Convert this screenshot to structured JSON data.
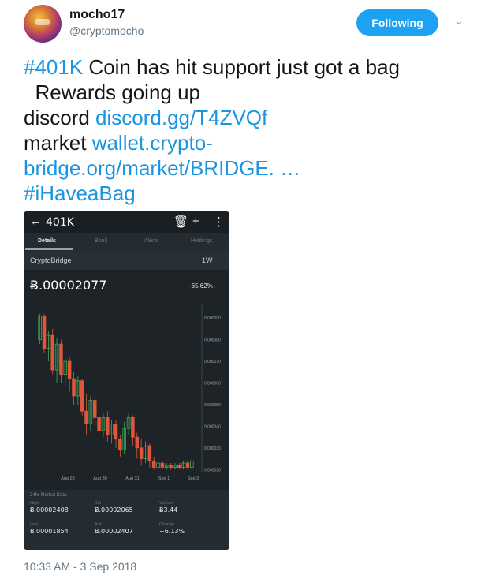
{
  "user": {
    "name": "mocho17",
    "handle": "@cryptomocho",
    "follow_label": "Following",
    "caret": "⌄"
  },
  "tweet": {
    "hashtag1": "#401K",
    "text1": " Coin has hit support  just got a bag",
    "text2": "  Rewards going up",
    "discord_label": "discord ",
    "discord_link": "discord.gg/T4ZVQf",
    "market_label": "market ",
    "market_link1": "wallet.crypto-",
    "market_link2": "bridge.org/market/BRIDGE. …",
    "hashtag2": "#iHaveaBag",
    "timestamp": "10:33 AM - 3 Sep 2018"
  },
  "app": {
    "back": "←",
    "coin": "401K",
    "icons": {
      "trash": "🗑",
      "add": "+",
      "more": "⋮"
    },
    "tabs": [
      "Details",
      "Book",
      "Alerts",
      "Holdings"
    ],
    "exchange": "CryptoBridge",
    "period": "1W",
    "price": "Ƀ.00002077",
    "change": "-65.62%",
    "change_arrow": "↓"
  },
  "chart_data": {
    "type": "candlestick",
    "y_ticks": [
      "0.000090",
      "0.000080",
      "0.000070",
      "0.000060",
      "0.000050",
      "0.000040",
      "0.000030",
      "0.000020"
    ],
    "x_ticks": [
      "Aug 28",
      "Aug 30",
      "Aug 31",
      "Sep 1",
      "Sep 3"
    ],
    "ylim": [
      1.9e-05,
      9.7e-05
    ],
    "candles": [
      [
        8e-05,
        9.1e-05,
        7.8e-05,
        9.2e-05
      ],
      [
        9.1e-05,
        7.6e-05,
        7.4e-05,
        9.2e-05
      ],
      [
        7.6e-05,
        8.2e-05,
        7e-05,
        8.4e-05
      ],
      [
        8.2e-05,
        6.6e-05,
        6.4e-05,
        8.5e-05
      ],
      [
        6.6e-05,
        7.8e-05,
        6e-05,
        8.1e-05
      ],
      [
        7.8e-05,
        6.4e-05,
        6e-05,
        8e-05
      ],
      [
        6.4e-05,
        7e-05,
        5.8e-05,
        7.2e-05
      ],
      [
        7e-05,
        6.2e-05,
        5.6e-05,
        7.2e-05
      ],
      [
        6.2e-05,
        5.4e-05,
        5e-05,
        6.5e-05
      ],
      [
        5.4e-05,
        6.1e-05,
        5e-05,
        6.3e-05
      ],
      [
        6.1e-05,
        4.7e-05,
        4.5e-05,
        6.2e-05
      ],
      [
        4.7e-05,
        4.1e-05,
        3.6e-05,
        5.5e-05
      ],
      [
        4.1e-05,
        5.2e-05,
        3.8e-05,
        5.4e-05
      ],
      [
        5.2e-05,
        4.4e-05,
        4e-05,
        5.3e-05
      ],
      [
        4.4e-05,
        3.8e-05,
        3.2e-05,
        4.8e-05
      ],
      [
        3.8e-05,
        4.4e-05,
        3.5e-05,
        4.6e-05
      ],
      [
        4.4e-05,
        3.6e-05,
        3.3e-05,
        4.7e-05
      ],
      [
        3.6e-05,
        4.1e-05,
        3.2e-05,
        4.3e-05
      ],
      [
        4.1e-05,
        3.4e-05,
        3e-05,
        4.3e-05
      ],
      [
        3.4e-05,
        2.9e-05,
        2.6e-05,
        3.6e-05
      ],
      [
        2.9e-05,
        3.9e-05,
        2.7e-05,
        4.2e-05
      ],
      [
        3.9e-05,
        4.4e-05,
        3.6e-05,
        4.6e-05
      ],
      [
        4.4e-05,
        3.5e-05,
        3.1e-05,
        4.5e-05
      ],
      [
        3.5e-05,
        3e-05,
        2.5e-05,
        3.7e-05
      ],
      [
        3e-05,
        2.5e-05,
        2.2e-05,
        3.4e-05
      ],
      [
        2.5e-05,
        3.1e-05,
        2.3e-05,
        3.3e-05
      ],
      [
        3.1e-05,
        2.4e-05,
        2.1e-05,
        3.2e-05
      ],
      [
        2.4e-05,
        2.1e-05,
        2e-05,
        2.6e-05
      ],
      [
        2.1e-05,
        2.3e-05,
        2e-05,
        2.4e-05
      ],
      [
        2.3e-05,
        2.1e-05,
        2e-05,
        2.4e-05
      ],
      [
        2.1e-05,
        2.2e-05,
        2e-05,
        2.3e-05
      ],
      [
        2.2e-05,
        2.1e-05,
        2e-05,
        2.3e-05
      ],
      [
        2.1e-05,
        2.2e-05,
        2e-05,
        2.3e-05
      ],
      [
        2.2e-05,
        2.1e-05,
        2e-05,
        2.3e-05
      ],
      [
        2.1e-05,
        2.3e-05,
        2e-05,
        2.4e-05
      ],
      [
        2.3e-05,
        2.1e-05,
        2e-05,
        2.4e-05
      ],
      [
        2.1e-05,
        2.4e-05,
        2e-05,
        2.5e-05
      ]
    ]
  },
  "market": {
    "title": "24hr Market Data",
    "cells": [
      {
        "label": "High",
        "value": "Ƀ.00002408"
      },
      {
        "label": "Bid",
        "value": "Ƀ.00002065"
      },
      {
        "label": "Volume",
        "value": "Ƀ3.44"
      },
      {
        "label": "Low",
        "value": "Ƀ.00001854"
      },
      {
        "label": "Ask",
        "value": "Ƀ.00002407"
      },
      {
        "label": "Change",
        "value": "+6.13%"
      }
    ]
  },
  "colors": {
    "accent": "#1da1f2",
    "link": "#1b95e0",
    "up": "#3fae5a",
    "down": "#e0563a"
  }
}
